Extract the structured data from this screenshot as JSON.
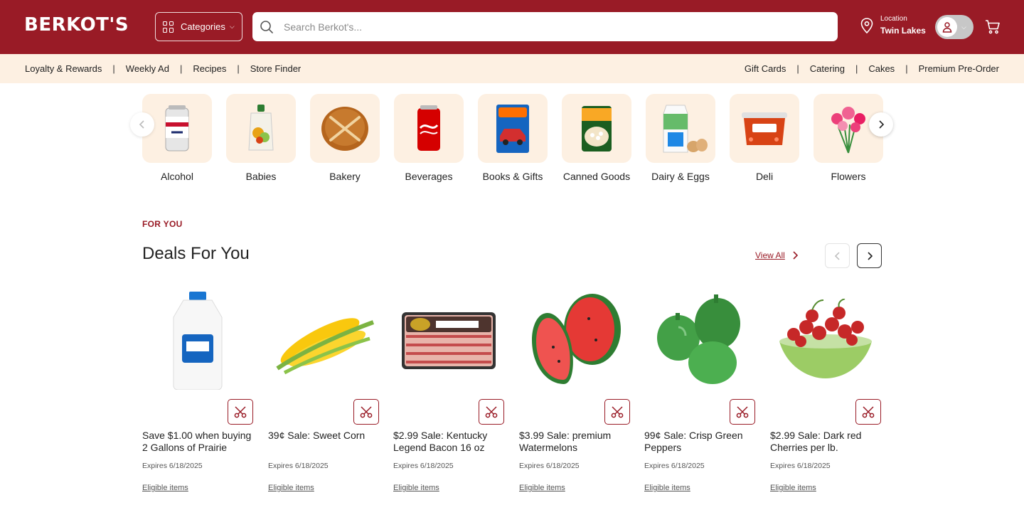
{
  "header": {
    "logo": "BERKOT'S",
    "categories_label": "Categories",
    "search_placeholder": "Search Berkot's...",
    "location_label": "Location",
    "location_value": "Twin Lakes"
  },
  "subnav": {
    "left": [
      "Loyalty & Rewards",
      "Weekly Ad",
      "Recipes",
      "Store Finder"
    ],
    "right": [
      "Gift Cards",
      "Catering",
      "Cakes",
      "Premium Pre-Order"
    ]
  },
  "categories": [
    {
      "name": "Alcohol",
      "icon": "beer-can-icon"
    },
    {
      "name": "Babies",
      "icon": "baby-food-pouch-icon"
    },
    {
      "name": "Bakery",
      "icon": "bread-roll-icon"
    },
    {
      "name": "Beverages",
      "icon": "soda-can-icon"
    },
    {
      "name": "Books & Gifts",
      "icon": "toy-car-icon"
    },
    {
      "name": "Canned Goods",
      "icon": "canned-beans-icon"
    },
    {
      "name": "Dairy & Eggs",
      "icon": "milk-carton-eggs-icon"
    },
    {
      "name": "Deli",
      "icon": "deli-container-icon"
    },
    {
      "name": "Flowers",
      "icon": "flower-bouquet-icon"
    }
  ],
  "deals": {
    "eyebrow": "FOR YOU",
    "title": "Deals For You",
    "view_all": "View All",
    "items": [
      {
        "title": "Save $1.00 when buying 2 Gallons of Prairie",
        "expires": "Expires 6/18/2025",
        "link": "Eligible items",
        "image": "milk-gallon"
      },
      {
        "title": "39¢ Sale: Sweet Corn",
        "expires": "Expires 6/18/2025",
        "link": "Eligible items",
        "image": "corn"
      },
      {
        "title": "$2.99 Sale: Kentucky Legend Bacon 16 oz",
        "expires": "Expires 6/18/2025",
        "link": "Eligible items",
        "image": "bacon"
      },
      {
        "title": "$3.99 Sale: premium Watermelons",
        "expires": "Expires 6/18/2025",
        "link": "Eligible items",
        "image": "watermelon"
      },
      {
        "title": "99¢ Sale: Crisp Green Peppers",
        "expires": "Expires 6/18/2025",
        "link": "Eligible items",
        "image": "green-peppers"
      },
      {
        "title": "$2.99 Sale: Dark red Cherries per lb.",
        "expires": "Expires 6/18/2025",
        "link": "Eligible items",
        "image": "cherries"
      }
    ]
  },
  "colors": {
    "brand": "#991b26",
    "cream": "#fdf0e2"
  }
}
